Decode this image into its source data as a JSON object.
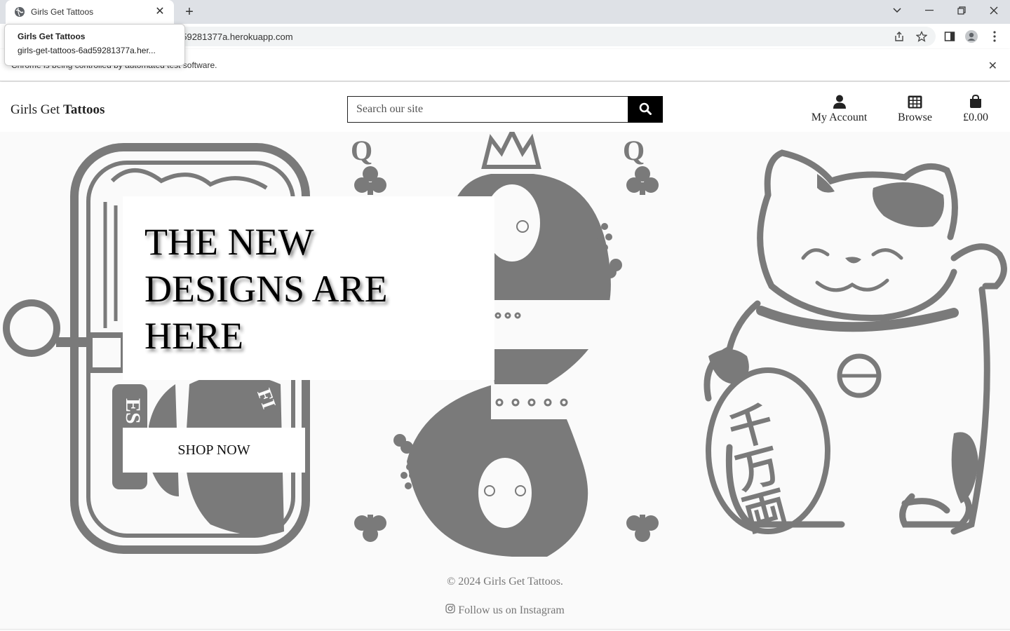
{
  "browser": {
    "tab_title": "Girls Get Tattoos",
    "url": "d59281377a.herokuapp.com",
    "infobar_text": "Chrome is being controlled by automated test software.",
    "tooltip": {
      "title": "Girls Get Tattoos",
      "url": "girls-get-tattoos-6ad59281377a.her..."
    }
  },
  "header": {
    "logo_light": "Girls Get",
    "logo_bold": "Tattoos",
    "search_placeholder": "Search our site",
    "nav": {
      "account": "My Account",
      "browse": "Browse",
      "bag_total": "£0.00"
    }
  },
  "hero": {
    "headline": "THE NEW DESIGNS ARE HERE",
    "cta": "SHOP NOW"
  },
  "footer": {
    "copyright": "© 2024 Girls Get Tattoos.",
    "instagram": "Follow us on Instagram"
  },
  "colors": {
    "art_gray": "#7a7a7a",
    "search_button": "#000000",
    "background": "#fafafa"
  }
}
